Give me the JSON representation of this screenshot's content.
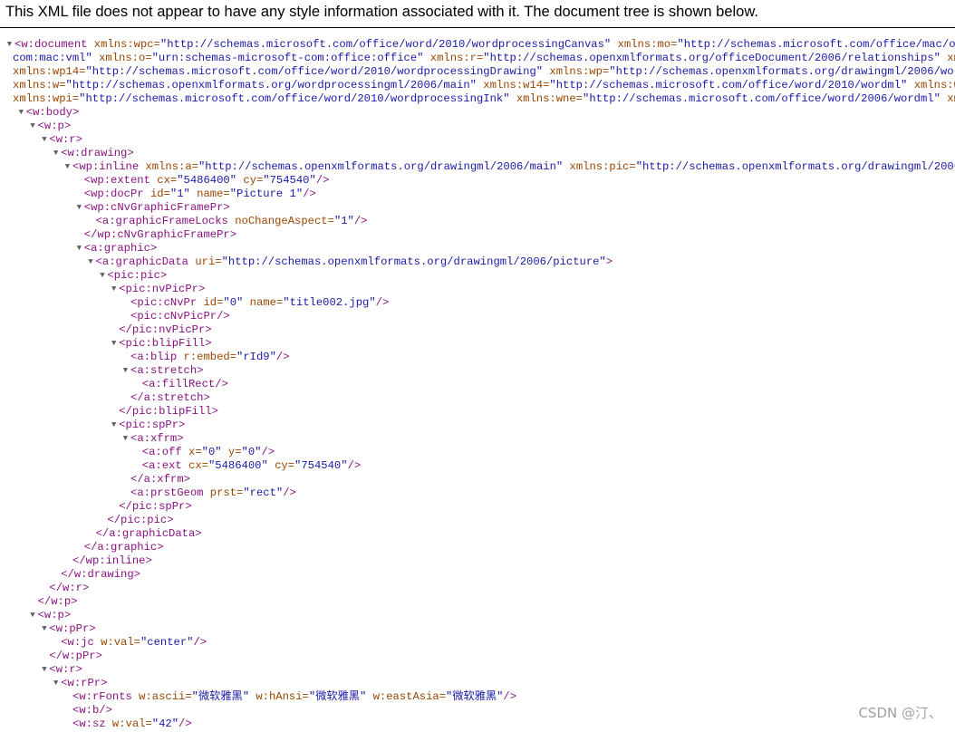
{
  "header": {
    "text": "This XML file does not appear to have any style information associated with it. The document tree is shown below."
  },
  "watermark": "CSDN @汀、",
  "lines": [
    {
      "indent": 0,
      "tri": true,
      "parts": [
        [
          "t",
          "<w:document "
        ],
        [
          "a",
          "xmlns:wpc="
        ],
        [
          "v",
          "\"http://schemas.microsoft.com/office/word/2010/wordprocessingCanvas\" "
        ],
        [
          "a",
          "xmlns:mo="
        ],
        [
          "v",
          "\"http://schemas.microsoft.com/office/mac/office/2"
        ]
      ]
    },
    {
      "indent": 0,
      "tri": false,
      "offset": 14,
      "parts": [
        [
          "v",
          "com:mac:vml\" "
        ],
        [
          "a",
          "xmlns:o="
        ],
        [
          "v",
          "\"urn:schemas-microsoft-com:office:office\" "
        ],
        [
          "a",
          "xmlns:r="
        ],
        [
          "v",
          "\"http://schemas.openxmlformats.org/officeDocument/2006/relationships\" "
        ],
        [
          "a",
          "xmlns:m="
        ]
      ]
    },
    {
      "indent": 0,
      "tri": false,
      "offset": 14,
      "parts": [
        [
          "a",
          "xmlns:wp14="
        ],
        [
          "v",
          "\"http://schemas.microsoft.com/office/word/2010/wordprocessingDrawing\" "
        ],
        [
          "a",
          "xmlns:wp="
        ],
        [
          "v",
          "\"http://schemas.openxmlformats.org/drawingml/2006/wordproce"
        ]
      ]
    },
    {
      "indent": 0,
      "tri": false,
      "offset": 14,
      "parts": [
        [
          "a",
          "xmlns:w="
        ],
        [
          "v",
          "\"http://schemas.openxmlformats.org/wordprocessingml/2006/main\" "
        ],
        [
          "a",
          "xmlns:w14="
        ],
        [
          "v",
          "\"http://schemas.microsoft.com/office/word/2010/wordml\" "
        ],
        [
          "a",
          "xmlns:wpg="
        ],
        [
          "v",
          "\"ht"
        ]
      ]
    },
    {
      "indent": 0,
      "tri": false,
      "offset": 14,
      "parts": [
        [
          "a",
          "xmlns:wpi="
        ],
        [
          "v",
          "\"http://schemas.microsoft.com/office/word/2010/wordprocessingInk\" "
        ],
        [
          "a",
          "xmlns:wne="
        ],
        [
          "v",
          "\"http://schemas.microsoft.com/office/word/2006/wordml\" "
        ],
        [
          "a",
          "xmlns:wp"
        ]
      ]
    },
    {
      "indent": 1,
      "tri": true,
      "parts": [
        [
          "t",
          "<w:body>"
        ]
      ]
    },
    {
      "indent": 2,
      "tri": true,
      "parts": [
        [
          "t",
          "<w:p>"
        ]
      ]
    },
    {
      "indent": 3,
      "tri": true,
      "parts": [
        [
          "t",
          "<w:r>"
        ]
      ]
    },
    {
      "indent": 4,
      "tri": true,
      "parts": [
        [
          "t",
          "<w:drawing>"
        ]
      ]
    },
    {
      "indent": 5,
      "tri": true,
      "parts": [
        [
          "t",
          "<wp:inline "
        ],
        [
          "a",
          "xmlns:a="
        ],
        [
          "v",
          "\"http://schemas.openxmlformats.org/drawingml/2006/main\" "
        ],
        [
          "a",
          "xmlns:pic="
        ],
        [
          "v",
          "\"http://schemas.openxmlformats.org/drawingml/2006/pict"
        ]
      ]
    },
    {
      "indent": 6,
      "tri": false,
      "parts": [
        [
          "t",
          "<wp:extent "
        ],
        [
          "a",
          "cx="
        ],
        [
          "v",
          "\"5486400\" "
        ],
        [
          "a",
          "cy="
        ],
        [
          "v",
          "\"754540\""
        ],
        [
          "t",
          "/>"
        ]
      ]
    },
    {
      "indent": 6,
      "tri": false,
      "parts": [
        [
          "t",
          "<wp:docPr "
        ],
        [
          "a",
          "id="
        ],
        [
          "v",
          "\"1\" "
        ],
        [
          "a",
          "name="
        ],
        [
          "v",
          "\"Picture 1\""
        ],
        [
          "t",
          "/>"
        ]
      ]
    },
    {
      "indent": 6,
      "tri": true,
      "parts": [
        [
          "t",
          "<wp:cNvGraphicFramePr>"
        ]
      ]
    },
    {
      "indent": 7,
      "tri": false,
      "parts": [
        [
          "t",
          "<a:graphicFrameLocks "
        ],
        [
          "a",
          "noChangeAspect="
        ],
        [
          "v",
          "\"1\""
        ],
        [
          "t",
          "/>"
        ]
      ]
    },
    {
      "indent": 6,
      "tri": false,
      "parts": [
        [
          "t",
          "</wp:cNvGraphicFramePr>"
        ]
      ]
    },
    {
      "indent": 6,
      "tri": true,
      "parts": [
        [
          "t",
          "<a:graphic>"
        ]
      ]
    },
    {
      "indent": 7,
      "tri": true,
      "parts": [
        [
          "t",
          "<a:graphicData "
        ],
        [
          "a",
          "uri="
        ],
        [
          "v",
          "\"http://schemas.openxmlformats.org/drawingml/2006/picture\""
        ],
        [
          "t",
          ">"
        ]
      ]
    },
    {
      "indent": 8,
      "tri": true,
      "parts": [
        [
          "t",
          "<pic:pic>"
        ]
      ]
    },
    {
      "indent": 9,
      "tri": true,
      "parts": [
        [
          "t",
          "<pic:nvPicPr>"
        ]
      ]
    },
    {
      "indent": 10,
      "tri": false,
      "parts": [
        [
          "t",
          "<pic:cNvPr "
        ],
        [
          "a",
          "id="
        ],
        [
          "v",
          "\"0\" "
        ],
        [
          "a",
          "name="
        ],
        [
          "v",
          "\"title002.jpg\""
        ],
        [
          "t",
          "/>"
        ]
      ]
    },
    {
      "indent": 10,
      "tri": false,
      "parts": [
        [
          "t",
          "<pic:cNvPicPr/>"
        ]
      ]
    },
    {
      "indent": 9,
      "tri": false,
      "parts": [
        [
          "t",
          "</pic:nvPicPr>"
        ]
      ]
    },
    {
      "indent": 9,
      "tri": true,
      "parts": [
        [
          "t",
          "<pic:blipFill>"
        ]
      ]
    },
    {
      "indent": 10,
      "tri": false,
      "parts": [
        [
          "t",
          "<a:blip "
        ],
        [
          "a",
          "r:embed="
        ],
        [
          "v",
          "\"rId9\""
        ],
        [
          "t",
          "/>"
        ]
      ]
    },
    {
      "indent": 10,
      "tri": true,
      "parts": [
        [
          "t",
          "<a:stretch>"
        ]
      ]
    },
    {
      "indent": 11,
      "tri": false,
      "parts": [
        [
          "t",
          "<a:fillRect/>"
        ]
      ]
    },
    {
      "indent": 10,
      "tri": false,
      "parts": [
        [
          "t",
          "</a:stretch>"
        ]
      ]
    },
    {
      "indent": 9,
      "tri": false,
      "parts": [
        [
          "t",
          "</pic:blipFill>"
        ]
      ]
    },
    {
      "indent": 9,
      "tri": true,
      "parts": [
        [
          "t",
          "<pic:spPr>"
        ]
      ]
    },
    {
      "indent": 10,
      "tri": true,
      "parts": [
        [
          "t",
          "<a:xfrm>"
        ]
      ]
    },
    {
      "indent": 11,
      "tri": false,
      "parts": [
        [
          "t",
          "<a:off "
        ],
        [
          "a",
          "x="
        ],
        [
          "v",
          "\"0\" "
        ],
        [
          "a",
          "y="
        ],
        [
          "v",
          "\"0\""
        ],
        [
          "t",
          "/>"
        ]
      ]
    },
    {
      "indent": 11,
      "tri": false,
      "parts": [
        [
          "t",
          "<a:ext "
        ],
        [
          "a",
          "cx="
        ],
        [
          "v",
          "\"5486400\" "
        ],
        [
          "a",
          "cy="
        ],
        [
          "v",
          "\"754540\""
        ],
        [
          "t",
          "/>"
        ]
      ]
    },
    {
      "indent": 10,
      "tri": false,
      "parts": [
        [
          "t",
          "</a:xfrm>"
        ]
      ]
    },
    {
      "indent": 10,
      "tri": false,
      "parts": [
        [
          "t",
          "<a:prstGeom "
        ],
        [
          "a",
          "prst="
        ],
        [
          "v",
          "\"rect\""
        ],
        [
          "t",
          "/>"
        ]
      ]
    },
    {
      "indent": 9,
      "tri": false,
      "parts": [
        [
          "t",
          "</pic:spPr>"
        ]
      ]
    },
    {
      "indent": 8,
      "tri": false,
      "parts": [
        [
          "t",
          "</pic:pic>"
        ]
      ]
    },
    {
      "indent": 7,
      "tri": false,
      "parts": [
        [
          "t",
          "</a:graphicData>"
        ]
      ]
    },
    {
      "indent": 6,
      "tri": false,
      "parts": [
        [
          "t",
          "</a:graphic>"
        ]
      ]
    },
    {
      "indent": 5,
      "tri": false,
      "parts": [
        [
          "t",
          "</wp:inline>"
        ]
      ]
    },
    {
      "indent": 4,
      "tri": false,
      "parts": [
        [
          "t",
          "</w:drawing>"
        ]
      ]
    },
    {
      "indent": 3,
      "tri": false,
      "parts": [
        [
          "t",
          "</w:r>"
        ]
      ]
    },
    {
      "indent": 2,
      "tri": false,
      "parts": [
        [
          "t",
          "</w:p>"
        ]
      ]
    },
    {
      "indent": 2,
      "tri": true,
      "parts": [
        [
          "t",
          "<w:p>"
        ]
      ]
    },
    {
      "indent": 3,
      "tri": true,
      "parts": [
        [
          "t",
          "<w:pPr>"
        ]
      ]
    },
    {
      "indent": 4,
      "tri": false,
      "parts": [
        [
          "t",
          "<w:jc "
        ],
        [
          "a",
          "w:val="
        ],
        [
          "v",
          "\"center\""
        ],
        [
          "t",
          "/>"
        ]
      ]
    },
    {
      "indent": 3,
      "tri": false,
      "parts": [
        [
          "t",
          "</w:pPr>"
        ]
      ]
    },
    {
      "indent": 3,
      "tri": true,
      "parts": [
        [
          "t",
          "<w:r>"
        ]
      ]
    },
    {
      "indent": 4,
      "tri": true,
      "parts": [
        [
          "t",
          "<w:rPr>"
        ]
      ]
    },
    {
      "indent": 5,
      "tri": false,
      "parts": [
        [
          "t",
          "<w:rFonts "
        ],
        [
          "a",
          "w:ascii="
        ],
        [
          "v",
          "\"微软雅黑\" "
        ],
        [
          "a",
          "w:hAnsi="
        ],
        [
          "v",
          "\"微软雅黑\" "
        ],
        [
          "a",
          "w:eastAsia="
        ],
        [
          "v",
          "\"微软雅黑\""
        ],
        [
          "t",
          "/>"
        ]
      ]
    },
    {
      "indent": 5,
      "tri": false,
      "parts": [
        [
          "t",
          "<w:b/>"
        ]
      ]
    },
    {
      "indent": 5,
      "tri": false,
      "parts": [
        [
          "t",
          "<w:sz "
        ],
        [
          "a",
          "w:val="
        ],
        [
          "v",
          "\"42\""
        ],
        [
          "t",
          "/>"
        ]
      ]
    }
  ]
}
